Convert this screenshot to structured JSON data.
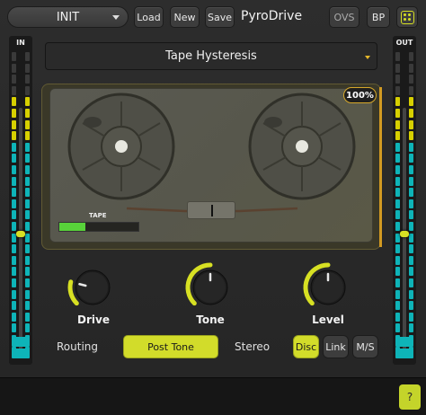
{
  "header": {
    "preset_name": "INIT",
    "load_label": "Load",
    "new_label": "New",
    "save_label": "Save",
    "plugin_title": "PyroDrive",
    "ovs_label": "OVS",
    "bp_label": "BP",
    "randomize_icon": "dice-icon"
  },
  "meters": {
    "input_label": "IN",
    "output_label": "OUT"
  },
  "algorithm": {
    "selected": "Tape Hysteresis"
  },
  "tape": {
    "mix_percent": "100%",
    "tape_label": "TAPE",
    "tape_level_fraction": 0.33
  },
  "knobs": [
    {
      "label": "Drive",
      "value_fraction": 0.22
    },
    {
      "label": "Tone",
      "value_fraction": 0.5
    },
    {
      "label": "Level",
      "value_fraction": 0.5
    }
  ],
  "routing": {
    "routing_label": "Routing",
    "routing_value": "Post Tone",
    "stereo_label": "Stereo",
    "stereo_modes": [
      "Disc",
      "Link",
      "M/S"
    ],
    "stereo_selected": "Disc"
  },
  "footer": {
    "help_label": "?"
  },
  "colors": {
    "accent": "#d7e023",
    "meter_cyan": "#0eb4b8",
    "meter_yellow": "#d7d000",
    "tape_fill": "#58d23a"
  }
}
